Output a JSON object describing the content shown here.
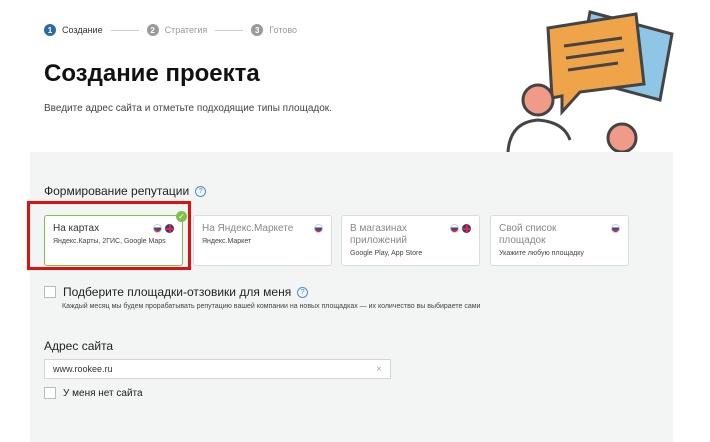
{
  "steps": [
    {
      "num": "1",
      "label": "Создание"
    },
    {
      "num": "2",
      "label": "Стратегия"
    },
    {
      "num": "3",
      "label": "Готово"
    }
  ],
  "header": {
    "title": "Создание проекта",
    "subtitle": "Введите адрес сайта и отметьте подходящие типы площадок."
  },
  "reputation": {
    "title": "Формирование репутации",
    "help": "?",
    "cards": [
      {
        "name": "На картах",
        "sub": "Яндекс.Карты, 2ГИС, Google Maps",
        "selected": true
      },
      {
        "name": "На Яндекс.Маркете",
        "sub": "Яндекс.Маркет",
        "selected": false
      },
      {
        "name": "В магазинах приложений",
        "sub": "Google Play, App Store",
        "selected": false
      },
      {
        "name": "Свой список площадок",
        "sub": "Укажите любую площадку",
        "selected": false
      }
    ]
  },
  "pick": {
    "label": "Подберите площадки-отзовики для меня",
    "help": "?",
    "note": "Каждый месяц мы будем прорабатывать репутацию вашей компании на новых площадках — их количество вы выбираете сами"
  },
  "site": {
    "label": "Адрес сайта",
    "value": "www.rookee.ru",
    "clear": "×",
    "no_site_label": "У меня нет сайта"
  },
  "check_glyph": "✓",
  "colors": {
    "accent": "#2d6aa8",
    "selected_border": "#7cc24a",
    "highlight": "#e01010",
    "panel": "#f3f4f4"
  }
}
